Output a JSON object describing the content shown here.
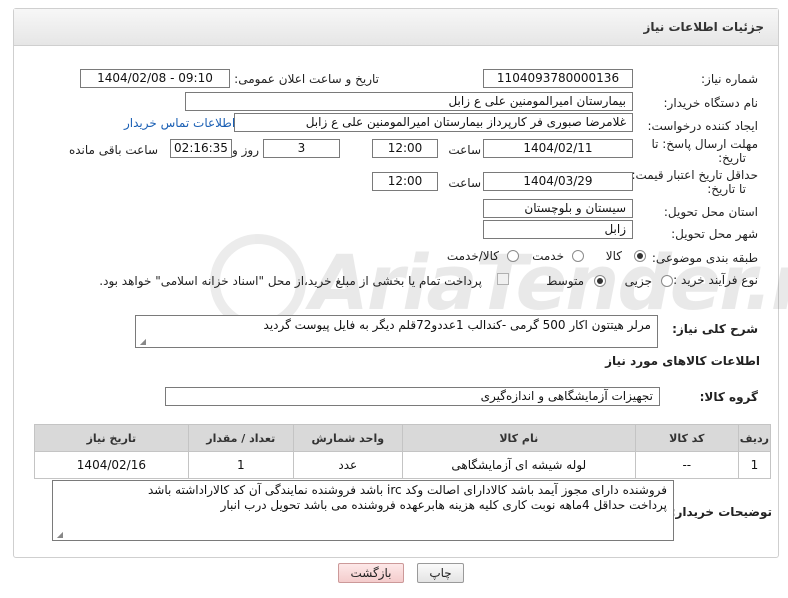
{
  "header": {
    "title": "جزئیات اطلاعات نیاز"
  },
  "watermark": "AriaTender.neT",
  "form": {
    "need_number_label": "شماره نیاز:",
    "need_number": "1104093780000136",
    "announce_label": "تاریخ و ساعت اعلان عمومی:",
    "announce_value": "1404/02/08 - 09:10",
    "buyer_org_label": "نام دستگاه خریدار:",
    "buyer_org": "بیمارستان امیرالمومنین علی  ع  زابل",
    "creator_label": "ایجاد کننده درخواست:",
    "creator": "غلامرضا صبوری فر کارپرداز بیمارستان امیرالمومنین علی  ع  زابل",
    "contact_link": "اطلاعات تماس خریدار",
    "deadline_label_1": "مهلت ارسال پاسخ: تا",
    "deadline_label_2": "تاریخ:",
    "deadline_date": "1404/02/11",
    "time_label": "ساعت",
    "deadline_time": "12:00",
    "days_value": "3",
    "days_label": "روز و",
    "remaining_time": "02:16:35",
    "remaining_label": "ساعت باقی مانده",
    "validity_label_1": "حداقل تاریخ اعتبار قیمت:",
    "validity_label_2": "تا تاریخ:",
    "validity_date": "1404/03/29",
    "validity_time": "12:00",
    "province_label": "استان محل تحویل:",
    "province": "سیستان و بلوچستان",
    "city_label": "شهر محل تحویل:",
    "city": "زابل",
    "category_label": "طبقه بندی موضوعی:",
    "category_options": [
      "کالا",
      "خدمت",
      "کالا/خدمت"
    ],
    "process_label": "نوع فرآیند خرید :",
    "process_options": [
      "جزیی",
      "متوسط"
    ],
    "payment_note": "پرداخت تمام یا بخشی از مبلغ خرید،از محل \"اسناد خزانه اسلامی\" خواهد بود.",
    "description_label": "شرح کلی نیاز:",
    "description": "مرلر هیتتون اکار 500 گرمی -کندالب  1عددو72قلم دیگر به فایل پیوست گردید",
    "goods_info_title": "اطلاعات کالاهای مورد نیاز",
    "goods_group_label": "گروه کالا:",
    "goods_group": "تجهیزات آزمایشگاهی و اندازه‌گیری"
  },
  "table": {
    "headers": [
      "ردیف",
      "کد کالا",
      "نام کالا",
      "واحد شمارش",
      "تعداد / مقدار",
      "تاریخ نیاز"
    ],
    "rows": [
      [
        "1",
        "--",
        "لوله شیشه ای آزمایشگاهی",
        "عدد",
        "1",
        "1404/02/16"
      ]
    ]
  },
  "buyer_notes": {
    "label": "توضیحات خریدار:",
    "line1": "فروشنده دارای مجوز آیمد باشد کالادارای اصالت وکد irc باشد فروشنده نمایندگی آن کد کالاراداشته باشد",
    "line2": "پرداخت حداقل 4ماهه نوبت کاری کلیه هزینه هابرعهده فروشنده می باشد تحویل درب انبار"
  },
  "buttons": {
    "print": "چاپ",
    "back": "بازگشت"
  }
}
